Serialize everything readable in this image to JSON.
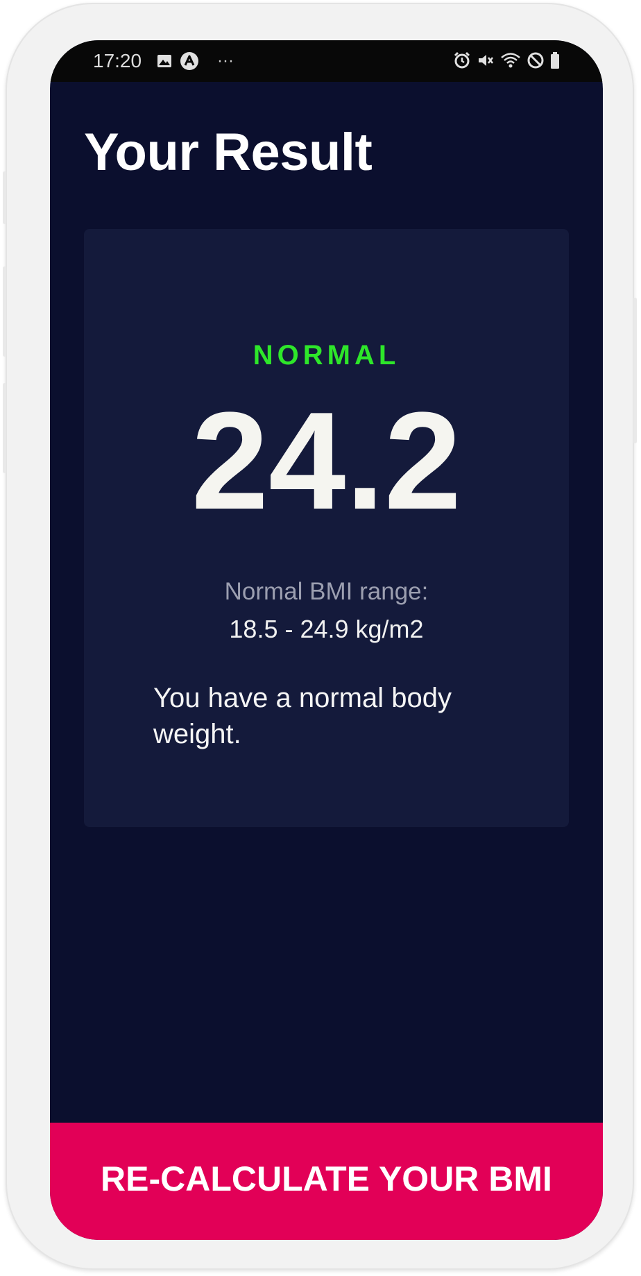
{
  "status_bar": {
    "time": "17:20",
    "more_indicator": "···",
    "left_icons": [
      "image-notification-icon",
      "app-notification-icon"
    ],
    "right_icons": [
      "alarm-icon",
      "vibrate-mute-icon",
      "wifi-icon",
      "do-not-disturb-icon",
      "battery-icon"
    ]
  },
  "page": {
    "title": "Your Result"
  },
  "result": {
    "status": "NORMAL",
    "bmi": "24.2",
    "range_label": "Normal BMI range:",
    "range_value": "18.5 - 24.9 kg/m2",
    "message": "You have a normal body weight."
  },
  "actions": {
    "recalculate_label": "RE-CALCULATE YOUR BMI"
  },
  "colors": {
    "background": "#0b0f2e",
    "card": "#141a3b",
    "status_normal": "#2ee62a",
    "accent_button": "#e20057"
  }
}
